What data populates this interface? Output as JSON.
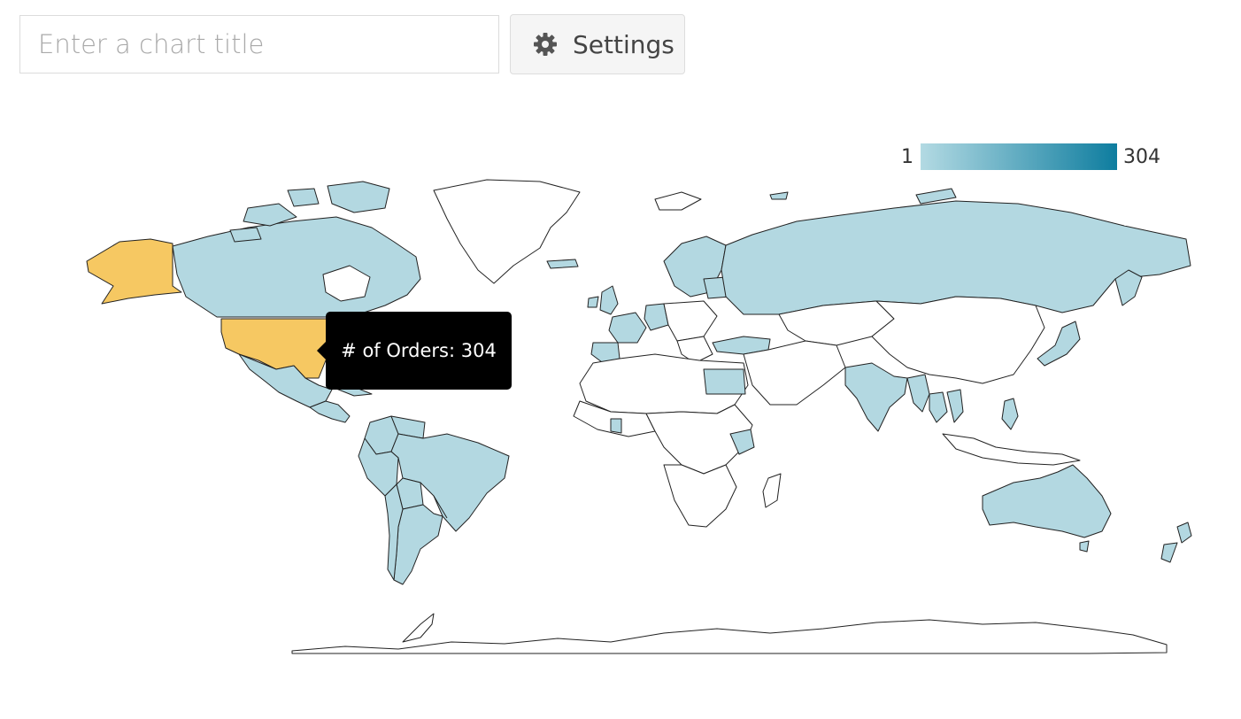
{
  "toolbar": {
    "title_placeholder": "Enter a chart title",
    "title_value": "",
    "settings_label": "Settings",
    "settings_icon": "gear-icon"
  },
  "legend": {
    "min_label": "1",
    "max_label": "304",
    "color_low": "#b3dae3",
    "color_high": "#0e7d9f"
  },
  "tooltip": {
    "text": "# of Orders: 304"
  },
  "map": {
    "highlight_color": "#f6c862",
    "data_color": "#b3d8e1",
    "no_data_color": "#ffffff",
    "highlighted_region": "United States",
    "regions_with_data": [
      "United States",
      "Canada",
      "Mexico",
      "Brazil",
      "Colombia",
      "Venezuela",
      "Peru",
      "Chile",
      "Argentina",
      "Bolivia",
      "Ecuador",
      "Paraguay",
      "Uruguay",
      "Ireland",
      "United Kingdom",
      "France",
      "Spain",
      "Germany",
      "Netherlands",
      "Belgium",
      "Norway",
      "Sweden",
      "Finland",
      "Poland",
      "Russia",
      "Turkey",
      "Egypt",
      "Kenya",
      "Ghana",
      "India",
      "Myanmar",
      "Thailand",
      "Vietnam",
      "Philippines",
      "Japan",
      "Australia",
      "New Zealand"
    ]
  }
}
